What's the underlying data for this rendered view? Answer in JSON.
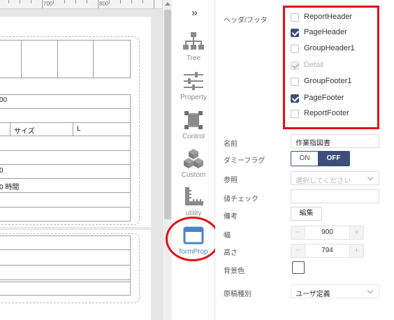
{
  "ruler": {
    "labels": [
      "700",
      "800"
    ]
  },
  "canvas": {
    "cell_texts": [
      "00",
      "サイズ",
      "L",
      "0",
      "0 時間"
    ]
  },
  "toolbar": {
    "collapse_icon": "double-chevron-right",
    "tools": [
      {
        "name": "tree",
        "label": "Tree",
        "icon": "tree-icon",
        "active": false
      },
      {
        "name": "property",
        "label": "Property",
        "icon": "sliders-icon",
        "active": false
      },
      {
        "name": "control",
        "label": "Control",
        "icon": "control-icon",
        "active": false
      },
      {
        "name": "custom",
        "label": "Custom",
        "icon": "cubes-icon",
        "active": false
      },
      {
        "name": "utility",
        "label": "utility",
        "icon": "ruler-icon",
        "active": false
      },
      {
        "name": "formprop",
        "label": "formProp",
        "icon": "window-icon",
        "active": true
      }
    ]
  },
  "props": {
    "header_footer": {
      "label": "ヘッダ/フッタ",
      "items": [
        {
          "label": "ReportHeader",
          "checked": false,
          "disabled": false
        },
        {
          "label": "PageHeader",
          "checked": true,
          "disabled": false
        },
        {
          "label": "GroupHeader1",
          "checked": false,
          "disabled": false
        },
        {
          "label": "Detail",
          "checked": true,
          "disabled": true
        },
        {
          "label": "GroupFooter1",
          "checked": false,
          "disabled": false
        },
        {
          "label": "PageFooter",
          "checked": true,
          "disabled": false
        },
        {
          "label": "ReportFooter",
          "checked": false,
          "disabled": false
        }
      ]
    },
    "name": {
      "label": "名前",
      "value": "作業指図書"
    },
    "dummy_flag": {
      "label": "ダミーフラグ",
      "on_label": "ON",
      "off_label": "OFF",
      "selected": "OFF"
    },
    "reference": {
      "label": "参照",
      "placeholder": "選択してください"
    },
    "value_check": {
      "label": "値チェック",
      "value": ""
    },
    "remarks": {
      "label": "備考",
      "button_label": "編集"
    },
    "width": {
      "label": "幅",
      "value": "900",
      "minus": "−",
      "plus": "+"
    },
    "height": {
      "label": "高さ",
      "value": "794",
      "minus": "−",
      "plus": "+"
    },
    "bgcolor": {
      "label": "背景色",
      "color": "#ffffff"
    },
    "paper_type": {
      "label": "原稿種別",
      "value": "ユーザ定義"
    }
  },
  "colors": {
    "accent": "#3b4f7a",
    "highlight": "#e10f16",
    "active_tool": "#4a84c6"
  }
}
